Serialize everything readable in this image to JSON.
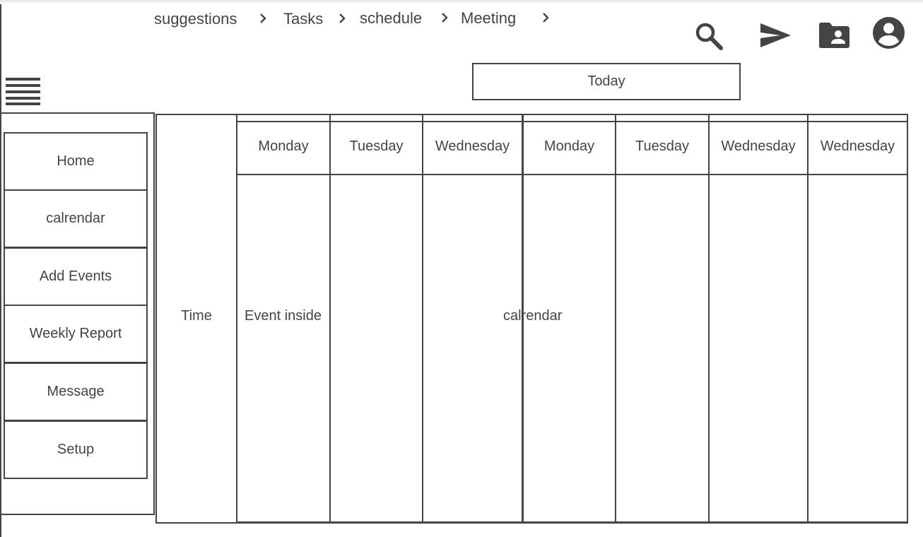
{
  "breadcrumb": [
    "suggestions",
    "Tasks",
    "schedule",
    "Meeting"
  ],
  "top_icons": [
    "search-icon",
    "send-icon",
    "contact-folder-icon",
    "account-icon"
  ],
  "today_label": "Today",
  "sidebar": {
    "items": [
      "Home",
      "calrendar",
      "Add Events",
      "Weekly Report",
      "Message",
      "Setup"
    ]
  },
  "calendar": {
    "time_label": "Time",
    "days": [
      "Monday",
      "Tuesday",
      "Wednesday",
      "Monday",
      "Tuesday",
      "Wednesday",
      "Wednesday"
    ],
    "event_text": "Event inside",
    "center_text": "calrendar"
  }
}
